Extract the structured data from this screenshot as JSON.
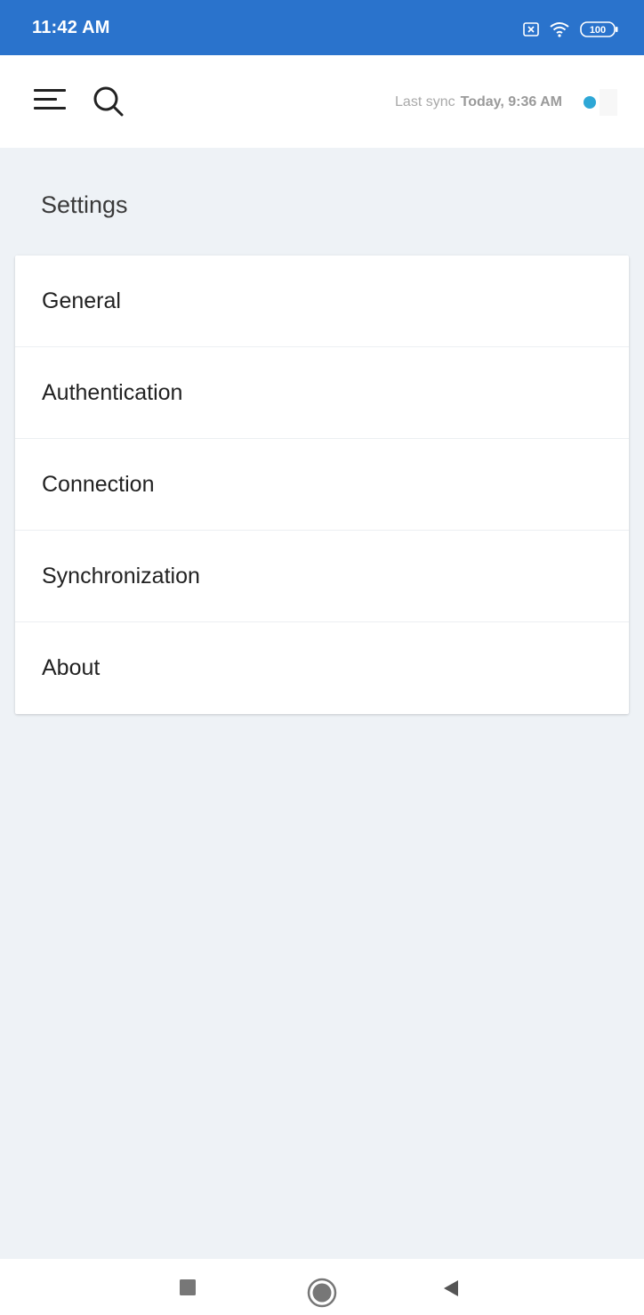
{
  "status_bar": {
    "time": "11:42 AM",
    "battery": "100",
    "icons": [
      "notification-x-icon",
      "wifi-icon",
      "battery-icon"
    ]
  },
  "header": {
    "sync_prefix": "Last sync",
    "sync_time": "Today, 9:36 AM",
    "sync_status_color": "#2ea7d6"
  },
  "page": {
    "title": "Settings"
  },
  "settings": {
    "items": [
      {
        "label": "General"
      },
      {
        "label": "Authentication"
      },
      {
        "label": "Connection"
      },
      {
        "label": "Synchronization"
      },
      {
        "label": "About"
      }
    ]
  },
  "nav": {
    "icons": [
      "recent-apps-icon",
      "home-icon",
      "back-icon"
    ]
  },
  "colors": {
    "status_bar": "#2a73cc",
    "background": "#eef2f6"
  }
}
